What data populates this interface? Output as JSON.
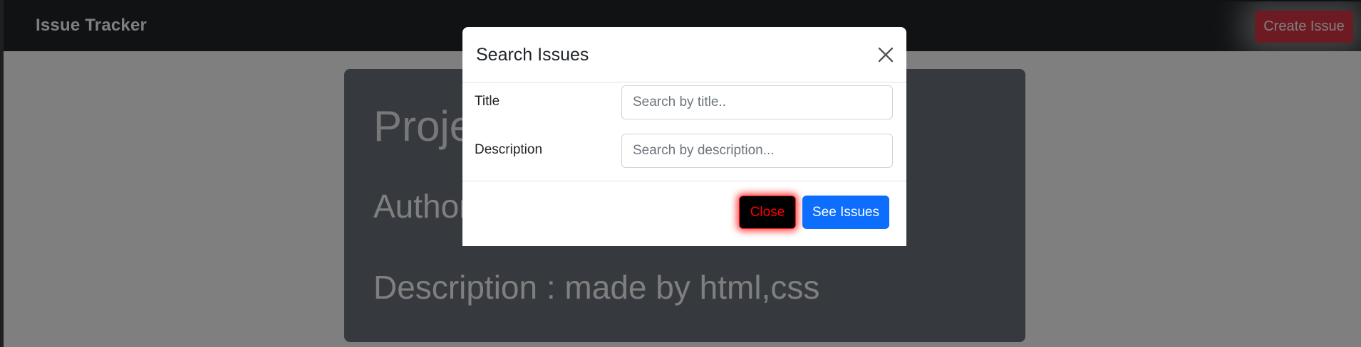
{
  "navbar": {
    "brand": "Issue Tracker",
    "create_button": "Create Issue"
  },
  "card": {
    "title": "Project",
    "author": "Author",
    "description": "Description : made by html,css"
  },
  "modal": {
    "title": "Search Issues",
    "fields": [
      {
        "label": "Title",
        "placeholder": "Search by title..",
        "value": ""
      },
      {
        "label": "Description",
        "placeholder": "Search by description...",
        "value": ""
      }
    ],
    "close_button": "Close",
    "submit_button": "See Issues"
  },
  "colors": {
    "navbar_bg": "#212529",
    "danger": "#dc3545",
    "primary": "#0d6efd",
    "card_bg": "#6c757d"
  }
}
